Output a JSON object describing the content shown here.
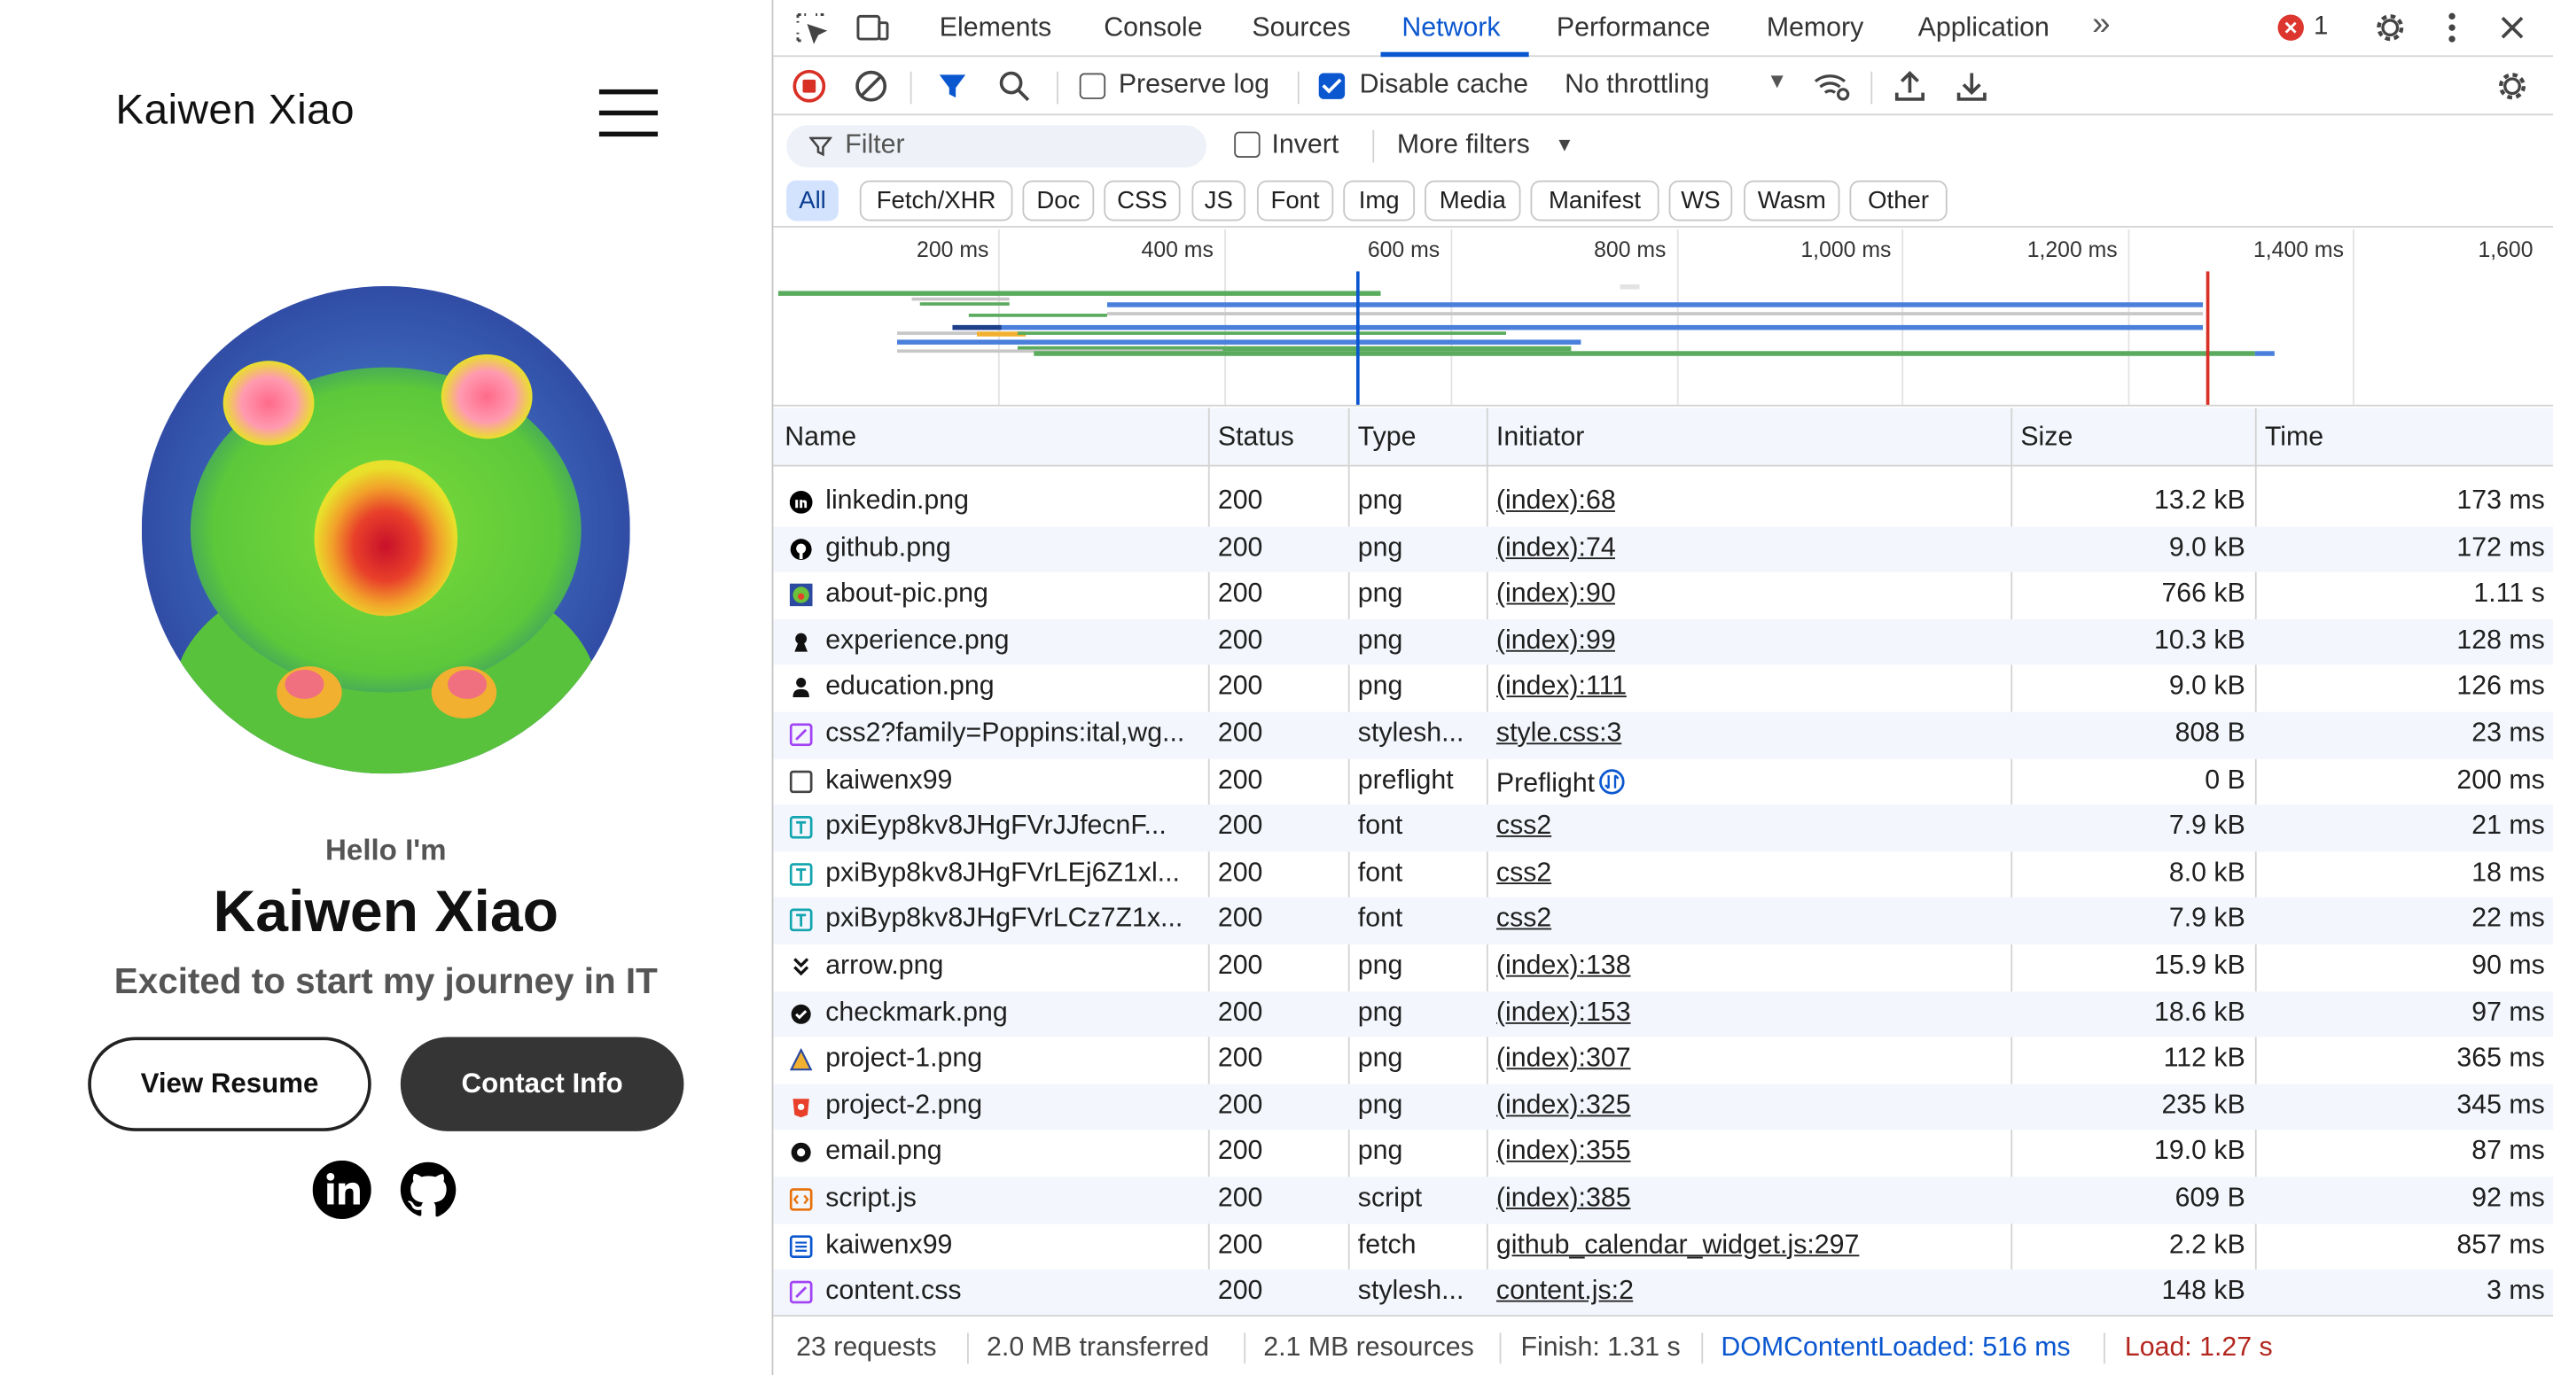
{
  "site": {
    "logo": "Kaiwen Xiao",
    "hello": "Hello I'm",
    "name": "Kaiwen Xiao",
    "tagline": "Excited to start my journey in IT",
    "resume_button": "View Resume",
    "contact_button": "Contact Info"
  },
  "devtools": {
    "tabs": [
      "Elements",
      "Console",
      "Sources",
      "Network",
      "Performance",
      "Memory",
      "Application"
    ],
    "active_tab": "Network",
    "error_count": "1",
    "toolbar": {
      "preserve_log": "Preserve log",
      "disable_cache": "Disable cache",
      "disable_cache_checked": true,
      "preserve_log_checked": false,
      "throttling": "No throttling"
    },
    "filter": {
      "placeholder": "Filter",
      "invert": "Invert",
      "more_filters": "More filters"
    },
    "type_filters": [
      "All",
      "Fetch/XHR",
      "Doc",
      "CSS",
      "JS",
      "Font",
      "Img",
      "Media",
      "Manifest",
      "WS",
      "Wasm",
      "Other"
    ],
    "overview_ticks": [
      "200 ms",
      "400 ms",
      "600 ms",
      "800 ms",
      "1,000 ms",
      "1,200 ms",
      "1,400 ms",
      "1,600"
    ],
    "columns": [
      "Name",
      "Status",
      "Type",
      "Initiator",
      "Size",
      "Time"
    ],
    "requests": [
      {
        "name": "linkedin.png",
        "status": "200",
        "type": "png",
        "initiator": "(index):68",
        "size": "13.2 kB",
        "time": "173 ms",
        "icon": "linkedin-file-icon"
      },
      {
        "name": "github.png",
        "status": "200",
        "type": "png",
        "initiator": "(index):74",
        "size": "9.0 kB",
        "time": "172 ms",
        "icon": "github-file-icon"
      },
      {
        "name": "about-pic.png",
        "status": "200",
        "type": "png",
        "initiator": "(index):90",
        "size": "766 kB",
        "time": "1.11 s",
        "icon": "image-file-icon"
      },
      {
        "name": "experience.png",
        "status": "200",
        "type": "png",
        "initiator": "(index):99",
        "size": "10.3 kB",
        "time": "128 ms",
        "icon": "experience-file-icon"
      },
      {
        "name": "education.png",
        "status": "200",
        "type": "png",
        "initiator": "(index):111",
        "size": "9.0 kB",
        "time": "126 ms",
        "icon": "education-file-icon"
      },
      {
        "name": "css2?family=Poppins:ital,wg...",
        "status": "200",
        "type": "stylesh...",
        "initiator": "style.css:3",
        "size": "808 B",
        "time": "23 ms",
        "icon": "stylesheet-file-icon"
      },
      {
        "name": "kaiwenx99",
        "status": "200",
        "type": "preflight",
        "initiator": "Preflight",
        "size": "0 B",
        "time": "200 ms",
        "icon": "preflight-file-icon"
      },
      {
        "name": "pxiEyp8kv8JHgFVrJJfecnF...",
        "status": "200",
        "type": "font",
        "initiator": "css2",
        "size": "7.9 kB",
        "time": "21 ms",
        "icon": "font-file-icon"
      },
      {
        "name": "pxiByp8kv8JHgFVrLEj6Z1xl...",
        "status": "200",
        "type": "font",
        "initiator": "css2",
        "size": "8.0 kB",
        "time": "18 ms",
        "icon": "font-file-icon"
      },
      {
        "name": "pxiByp8kv8JHgFVrLCz7Z1x...",
        "status": "200",
        "type": "font",
        "initiator": "css2",
        "size": "7.9 kB",
        "time": "22 ms",
        "icon": "font-file-icon"
      },
      {
        "name": "arrow.png",
        "status": "200",
        "type": "png",
        "initiator": "(index):138",
        "size": "15.9 kB",
        "time": "90 ms",
        "icon": "arrow-file-icon"
      },
      {
        "name": "checkmark.png",
        "status": "200",
        "type": "png",
        "initiator": "(index):153",
        "size": "18.6 kB",
        "time": "97 ms",
        "icon": "checkmark-file-icon"
      },
      {
        "name": "project-1.png",
        "status": "200",
        "type": "png",
        "initiator": "(index):307",
        "size": "112 kB",
        "time": "365 ms",
        "icon": "image-file-icon"
      },
      {
        "name": "project-2.png",
        "status": "200",
        "type": "png",
        "initiator": "(index):325",
        "size": "235 kB",
        "time": "345 ms",
        "icon": "image-file-icon"
      },
      {
        "name": "email.png",
        "status": "200",
        "type": "png",
        "initiator": "(index):355",
        "size": "19.0 kB",
        "time": "87 ms",
        "icon": "email-file-icon"
      },
      {
        "name": "script.js",
        "status": "200",
        "type": "script",
        "initiator": "(index):385",
        "size": "609 B",
        "time": "92 ms",
        "icon": "script-file-icon"
      },
      {
        "name": "kaiwenx99",
        "status": "200",
        "type": "fetch",
        "initiator": "github_calendar_widget.js:297",
        "size": "2.2 kB",
        "time": "857 ms",
        "icon": "fetch-file-icon"
      },
      {
        "name": "content.css",
        "status": "200",
        "type": "stylesh...",
        "initiator": "content.js:2",
        "size": "148 kB",
        "time": "3 ms",
        "icon": "stylesheet-file-icon"
      }
    ],
    "summary": {
      "requests": "23 requests",
      "transferred": "2.0 MB transferred",
      "resources": "2.1 MB resources",
      "finish": "Finish: 1.31 s",
      "dom_content_loaded": "DOMContentLoaded: 516 ms",
      "load": "Load: 1.27 s"
    }
  },
  "colors": {
    "accent": "#0b57d0",
    "dcl_line": "#0b57d0",
    "load_line": "#d93025",
    "error": "#dc362e"
  }
}
